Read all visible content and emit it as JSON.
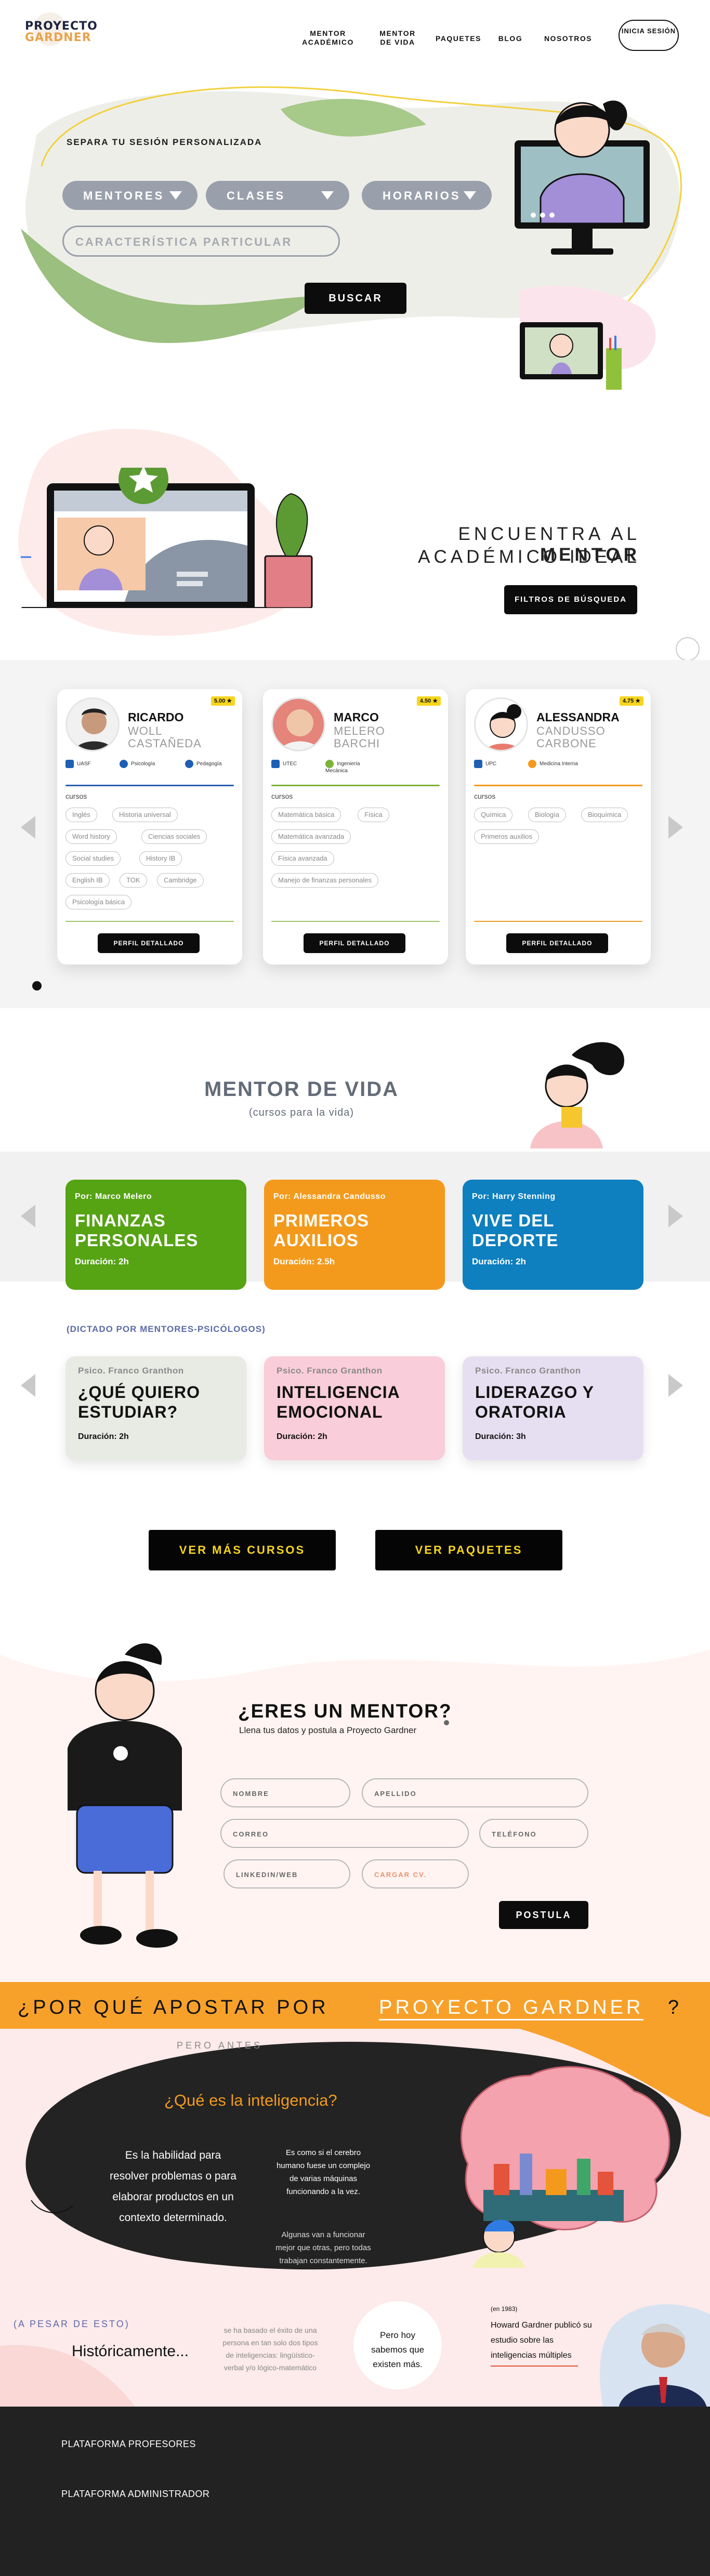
{
  "header": {
    "logo_top": "PROYECTO",
    "logo_bottom": "GARDNER",
    "nav": [
      {
        "label": "MENTOR ACADÉMICO"
      },
      {
        "label": "MENTOR DE VIDA"
      },
      {
        "label": "PAQUETES"
      },
      {
        "label": "BLOG"
      },
      {
        "label": "NOSOTROS"
      }
    ],
    "login": "INICIA SESIÓN"
  },
  "hero": {
    "title": "SEPARA TU SESIÓN PERSONALIZADA",
    "filters": [
      "MENTORES",
      "CLASES",
      "HORARIOS"
    ],
    "characteristic_placeholder": "CARACTERÍSTICA PARTICULAR",
    "search_button": "BUSCAR"
  },
  "ideal": {
    "line1_pre": "ENCUENTRA AL ",
    "line1_bold": "MENTOR",
    "line2": "ACADÉMICO IDEAL",
    "filters_button": "FILTROS DE BÚSQUEDA"
  },
  "mentors": [
    {
      "first": "RICARDO",
      "last1": "WOLL",
      "last2": "CASTAÑEDA",
      "rating": "5.00",
      "uni": "UASF",
      "spec1": "Psicología",
      "spec2": "Pedagogía",
      "cursos_label": "cursos",
      "courses": [
        "Inglés",
        "Historia universal",
        "Word history",
        "Ciencias sociales",
        "Social studies",
        "History IB",
        "English IB",
        "TOK",
        "Cambridge",
        "Psicología básica"
      ],
      "button": "PERFIL DETALLADO"
    },
    {
      "first": "MARCO",
      "last1": "MELERO",
      "last2": "BARCHI",
      "rating": "4.50",
      "uni": "UTEC",
      "spec1": "Ingeniería Mecánica",
      "spec2": "",
      "cursos_label": "cursos",
      "courses": [
        "Matemática básica",
        "Física",
        "Matemática avanzada",
        "Física avanzada",
        "Manejo de finanzas personales"
      ],
      "button": "PERFIL DETALLADO"
    },
    {
      "first": "ALESSANDRA",
      "last1": "CANDUSSO",
      "last2": "CARBONE",
      "rating": "4.75",
      "uni": "UPC",
      "spec1": "Medicina Interna",
      "spec2": "",
      "cursos_label": "cursos",
      "courses": [
        "Química",
        "Biología",
        "Bioquímica",
        "Primeros auxilios"
      ],
      "button": "PERFIL DETALLADO"
    }
  ],
  "life": {
    "title": "MENTOR DE VIDA",
    "subtitle": "(cursos para la vida)",
    "courses": [
      {
        "by": "Por: Marco Melero",
        "title": "FINANZAS PERSONALES",
        "duration": "Duración: 2h",
        "color": "#56a314"
      },
      {
        "by": "Por: Alessandra Candusso",
        "title": "PRIMEROS AUXILIOS",
        "duration": "Duración: 2.5h",
        "color": "#f39a1d"
      },
      {
        "by": "Por: Harry Stenning",
        "title": "VIVE DEL DEPORTE",
        "duration": "Duración: 2h",
        "color": "#0e7fbf"
      }
    ],
    "psych_label": "(DICTADO POR MENTORES-PSICÓLOGOS)",
    "psych_courses": [
      {
        "by": "Psico. Franco Granthon",
        "title": "¿QUÉ QUIERO ESTUDIAR?",
        "duration": "Duración: 2h",
        "color": "#e8eae4"
      },
      {
        "by": "Psico. Franco Granthon",
        "title": "INTELIGENCIA EMOCIONAL",
        "duration": "Duración: 2h",
        "color": "#f9cdd9"
      },
      {
        "by": "Psico. Franco Granthon",
        "title": "LIDERAZGO Y ORATORIA",
        "duration": "Duración: 3h",
        "color": "#e6dff1"
      }
    ],
    "more_courses": "VER MÁS CURSOS",
    "packages": "VER PAQUETES"
  },
  "apply": {
    "title": "¿ERES UN MENTOR?",
    "subtitle": "Llena tus datos y postula a Proyecto Gardner",
    "fields": {
      "nombre": "NOMBRE",
      "apellido": "APELLIDO",
      "correo": "CORREO",
      "telefono": "TELÉFONO",
      "linkedin": "LINKEDIN/WEB",
      "cv": "CARGAR CV."
    },
    "submit": "POSTULA"
  },
  "why": {
    "title_pre": "¿POR QUÉ APOSTAR POR",
    "title_brand": "PROYECTO GARDNER",
    "title_post": "?",
    "pero_antes": "PERO ANTES",
    "question": "¿Qué es la inteligencia?",
    "definition": "Es la habilidad para resolver problemas o para elaborar productos en un contexto determinado.",
    "brain_note": "Es como si el cerebro humano fuese un complejo de varias máquinas funcionando a la vez.",
    "brain_note2": "Algunas van a funcionar mejor que otras, pero todas trabajan constantemente.",
    "a_pesar": "(A PESAR DE ESTO)",
    "historicamente": "Históricamente...",
    "hist_note": "se ha basado el éxito de una persona en tan solo dos tipos de inteligencias: lingüístico-verbal y/o lógico-matemático",
    "bubble": "Pero hoy sabemos que existen más.",
    "gardner_note_year": "(en 1983)",
    "gardner_note": "Howard Gardner publicó su estudio sobre las inteligencias múltiples"
  },
  "footer": {
    "link1": "PLATAFORMA PROFESORES",
    "link2": "PLATAFORMA ADMINISTRADOR"
  },
  "colors": {
    "dark": "#1d2340",
    "yellow": "#f6d51d",
    "orange": "#f39a1d",
    "green": "#56a314",
    "blue": "#0e7fbf",
    "grey_chip": "#9aa0ab"
  }
}
